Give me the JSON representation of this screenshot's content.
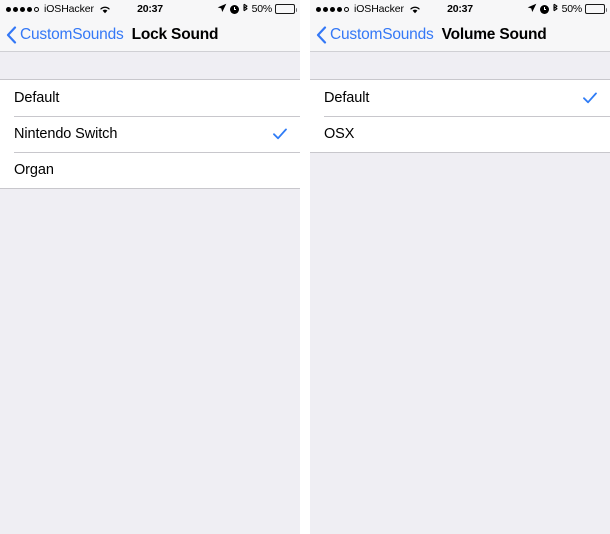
{
  "screens": [
    {
      "status_bar": {
        "signal_dots_filled": 4,
        "signal_dots_total": 5,
        "carrier": "iOSHacker",
        "wifi_icon": "wifi-icon",
        "time": "20:37",
        "location_icon": "location-arrow-icon",
        "alarm_icon": "alarm-clock-icon",
        "bluetooth_icon": "bluetooth-icon",
        "battery_percent": "50%",
        "battery_level": 50
      },
      "nav": {
        "back_icon": "chevron-left-icon",
        "back_label": "CustomSounds",
        "title": "Lock Sound"
      },
      "list": {
        "rows": [
          {
            "label": "Default",
            "checked": false
          },
          {
            "label": "Nintendo Switch",
            "checked": true
          },
          {
            "label": "Organ",
            "checked": false
          }
        ]
      }
    },
    {
      "status_bar": {
        "signal_dots_filled": 4,
        "signal_dots_total": 5,
        "carrier": "iOSHacker",
        "wifi_icon": "wifi-icon",
        "time": "20:37",
        "location_icon": "location-arrow-icon",
        "alarm_icon": "alarm-clock-icon",
        "bluetooth_icon": "bluetooth-icon",
        "battery_percent": "50%",
        "battery_level": 50
      },
      "nav": {
        "back_icon": "chevron-left-icon",
        "back_label": "CustomSounds",
        "title": "Volume Sound"
      },
      "list": {
        "rows": [
          {
            "label": "Default",
            "checked": true
          },
          {
            "label": "OSX",
            "checked": false
          }
        ]
      }
    }
  ],
  "colors": {
    "tint": "#3478f6",
    "checkmark": "#2f7cf6",
    "background": "#efeef3",
    "bar": "#f7f7f8",
    "separator": "#c8c7cc"
  }
}
